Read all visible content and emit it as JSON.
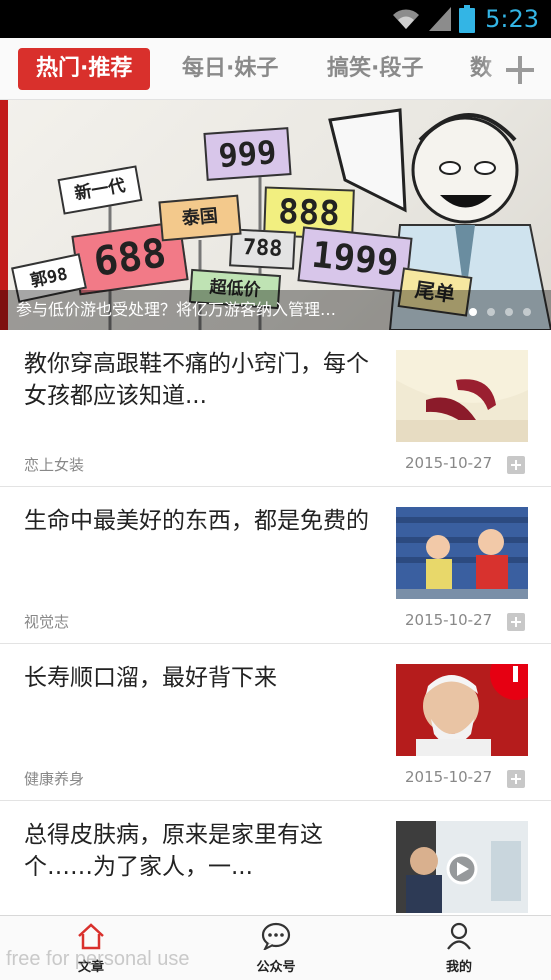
{
  "status_bar": {
    "time": "5:23"
  },
  "tabs": [
    {
      "label": "热门·推荐",
      "active": true
    },
    {
      "label": "每日·妹子",
      "active": false
    },
    {
      "label": "搞笑·段子",
      "active": false
    },
    {
      "label": "数",
      "active": false
    }
  ],
  "banner": {
    "caption": "参与低价游也受处理？将亿万游客纳入管理…",
    "signs": [
      "999",
      "888",
      "688",
      "788",
      "1999",
      "新一代",
      "泰国",
      "超低价",
      "尾单",
      "郭98"
    ],
    "page_count": 4,
    "current_page": 1
  },
  "articles": [
    {
      "title": "教你穿高跟鞋不痛的小窍门，每个女孩都应该知道...",
      "source": "恋上女装",
      "date": "2015-10-27"
    },
    {
      "title": "生命中最美好的东西，都是免费的",
      "source": "视觉志",
      "date": "2015-10-27"
    },
    {
      "title": "长寿顺口溜，最好背下来",
      "source": "健康养身",
      "date": "2015-10-27"
    },
    {
      "title": "总得皮肤病，原来是家里有这个……为了家人，一...",
      "source": "",
      "date": ""
    }
  ],
  "bottom_nav": [
    {
      "label": "文章",
      "icon": "home-icon",
      "active": true
    },
    {
      "label": "公众号",
      "icon": "chat-bubble-icon",
      "active": false
    },
    {
      "label": "我的",
      "icon": "person-icon",
      "active": false
    }
  ],
  "watermark": "free for personal use",
  "colors": {
    "accent": "#d9302c",
    "status_blue": "#33b5e5"
  }
}
